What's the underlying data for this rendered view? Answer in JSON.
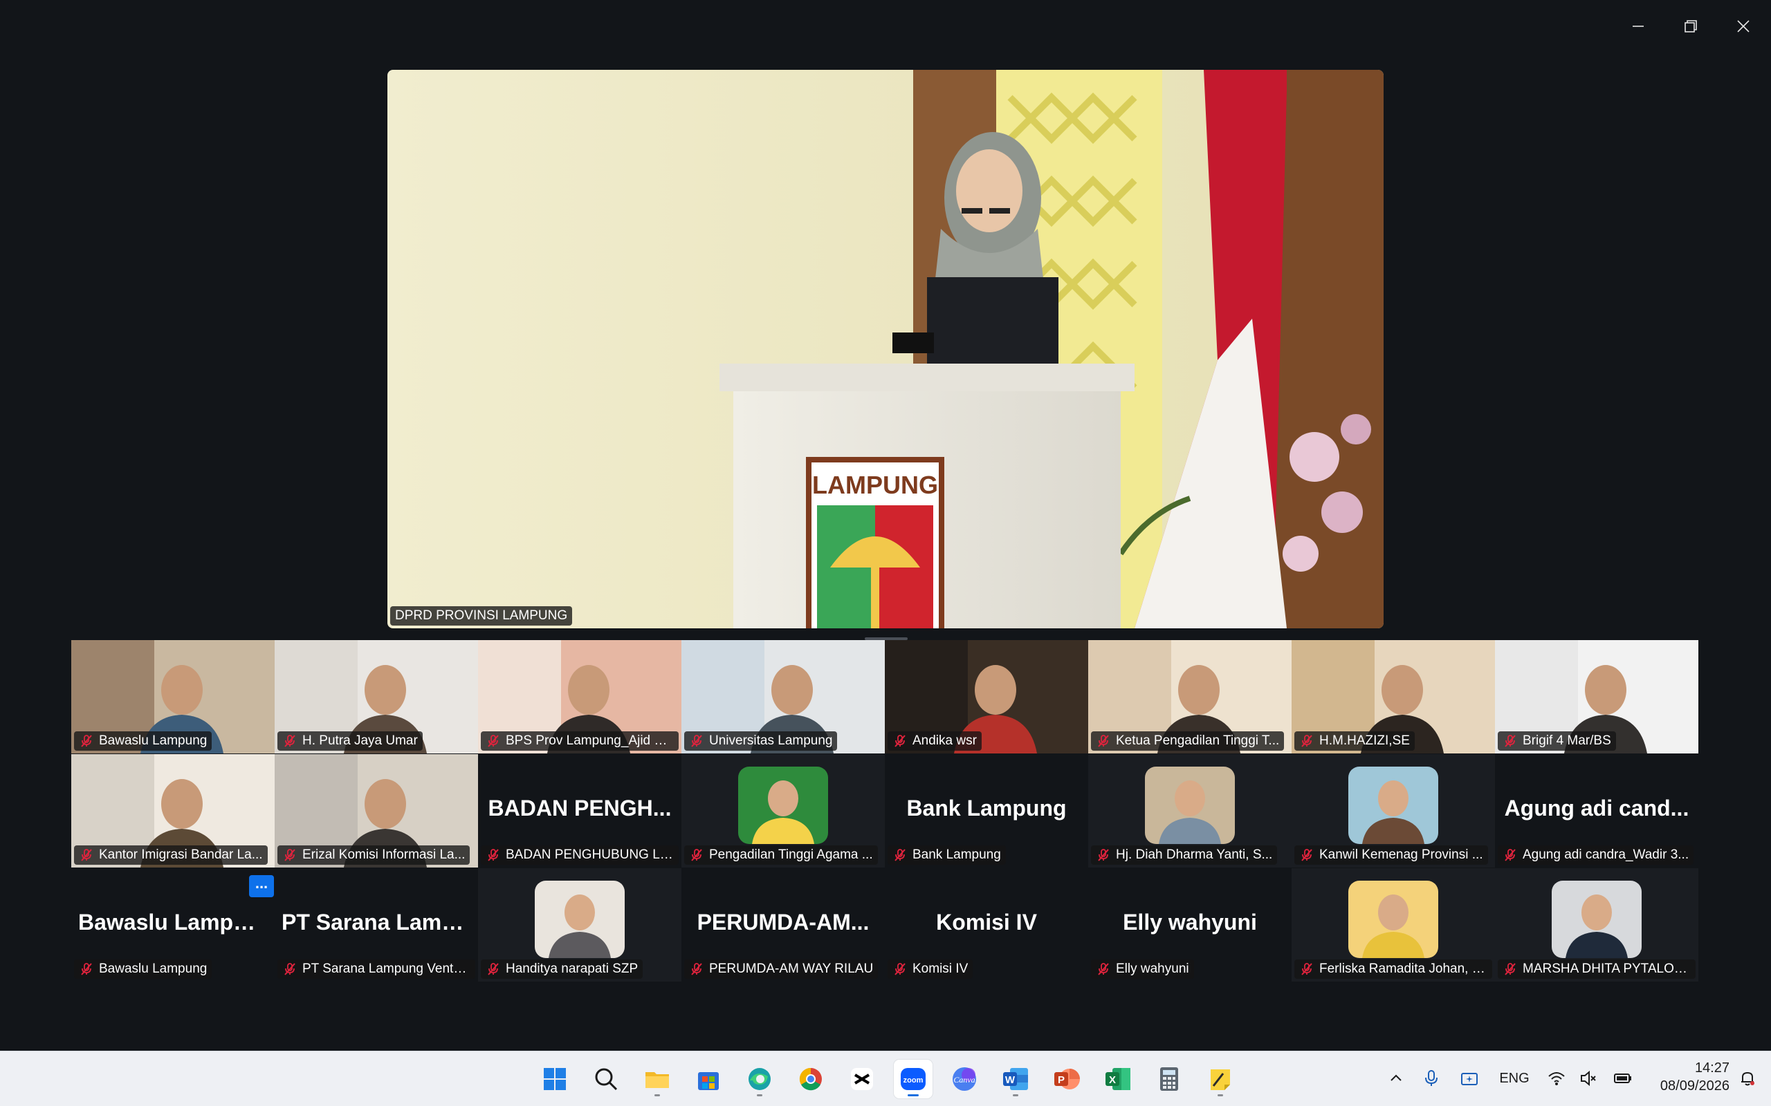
{
  "window": {
    "controls": [
      "minimize-icon",
      "restore-icon",
      "close-icon"
    ]
  },
  "speaker": {
    "name": "DPRD PROVINSI LAMPUNG",
    "podium_text": "LAMPUNG"
  },
  "participants": [
    {
      "name": "Bawaslu Lampung",
      "kind": "video"
    },
    {
      "name": "H. Putra Jaya Umar",
      "kind": "video"
    },
    {
      "name": "BPS Prov Lampung_Ajid H...",
      "kind": "video"
    },
    {
      "name": "Universitas Lampung",
      "kind": "video"
    },
    {
      "name": "Andika wsr",
      "kind": "video"
    },
    {
      "name": "Ketua Pengadilan Tinggi T...",
      "kind": "video"
    },
    {
      "name": "H.M.HAZIZI,SE",
      "kind": "video"
    },
    {
      "name": "Brigif 4 Mar/BS",
      "kind": "video"
    },
    {
      "name": "Kantor Imigrasi Bandar La...",
      "kind": "video"
    },
    {
      "name": "Erizal Komisi Informasi La...",
      "kind": "video"
    },
    {
      "name": "BADAN PENGHUBUNG LA...",
      "kind": "text",
      "big": "BADAN  PENGH..."
    },
    {
      "name": "Pengadilan Tinggi Agama ...",
      "kind": "avatar"
    },
    {
      "name": "Bank Lampung",
      "kind": "text",
      "big": "Bank Lampung"
    },
    {
      "name": "Hj. Diah Dharma  Yanti, S...",
      "kind": "avatar"
    },
    {
      "name": "Kanwil Kemenag Provinsi ...",
      "kind": "avatar"
    },
    {
      "name": "Agung adi candra_Wadir 3...",
      "kind": "text",
      "big": "Agung adi cand..."
    },
    {
      "name": "Bawaslu Lampung",
      "kind": "text",
      "big": "Bawaslu Lampung"
    },
    {
      "name": "PT Sarana Lampung Ventu...",
      "kind": "text",
      "big": "PT  Sarana Lamp..."
    },
    {
      "name": "Handitya narapati SZP",
      "kind": "avatar"
    },
    {
      "name": "PERUMDA-AM WAY RILAU",
      "kind": "text",
      "big": "PERUMDA-AM..."
    },
    {
      "name": "Komisi IV",
      "kind": "text",
      "big": "Komisi IV"
    },
    {
      "name": "Elly wahyuni",
      "kind": "text",
      "big": "Elly wahyuni"
    },
    {
      "name": "Ferliska Ramadita Johan, S...",
      "kind": "avatar"
    },
    {
      "name": "MARSHA DHITA PYTALOK...",
      "kind": "avatar"
    }
  ],
  "more_button": "...",
  "taskbar": {
    "apps": [
      "start-icon",
      "search-icon",
      "file-explorer-icon",
      "microsoft-store-icon",
      "edge-icon",
      "chrome-icon",
      "capcut-icon",
      "zoom-icon",
      "canva-icon",
      "word-icon",
      "powerpoint-icon",
      "excel-icon",
      "calculator-icon",
      "sticky-notes-icon"
    ],
    "active_app": "zoom-icon",
    "zoom_label": "zoom",
    "canva_label": "Canva",
    "language": "ENG",
    "time": "14:27",
    "date": "08/09/2026"
  }
}
